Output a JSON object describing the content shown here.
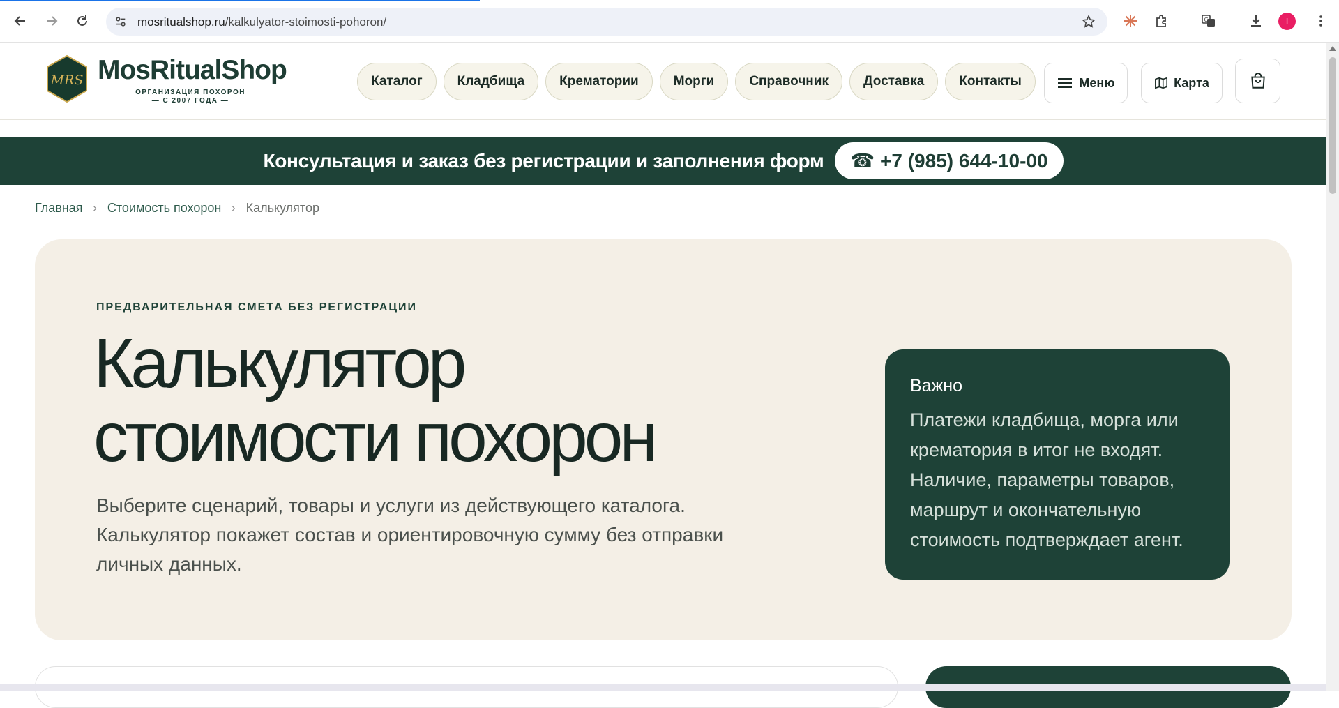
{
  "browser": {
    "url_host": "mosritualshop.ru",
    "url_path": "/kalkulyator-stoimosti-pohoron/",
    "profile_initial": "I"
  },
  "header": {
    "logo_title": "MosRitualShop",
    "logo_monogram": "MRS",
    "logo_subtitle_1": "ОРГАНИЗАЦИЯ ПОХОРОН",
    "logo_subtitle_2": "— С 2007 ГОДА —",
    "nav": [
      {
        "label": "Каталог"
      },
      {
        "label": "Кладбища"
      },
      {
        "label": "Крематории"
      },
      {
        "label": "Морги"
      },
      {
        "label": "Справочник"
      },
      {
        "label": "Доставка"
      },
      {
        "label": "Контакты"
      }
    ],
    "menu_label": "Меню",
    "map_label": "Карта"
  },
  "banner": {
    "text": "Консультация и заказ без регистрации и заполнения форм",
    "phone": "☎ +7 (985) 644-10-00"
  },
  "breadcrumb": {
    "home": "Главная",
    "parent": "Стоимость похорон",
    "current": "Калькулятор",
    "separator": "›"
  },
  "hero": {
    "eyebrow": "ПРЕДВАРИТЕЛЬНАЯ СМЕТА БЕЗ РЕГИСТРАЦИИ",
    "title": "Калькулятор стоимости похорон",
    "lead": "Выберите сценарий, товары и услуги из действующего каталога. Калькулятор покажет состав и ориентировочную сумму без отправки личных данных.",
    "notice_title": "Важно",
    "notice_body": "Платежи кладбища, морга или крематория в итог не входят. Наличие, параметры товаров, маршрут и окончательную стоимость подтверждает агент."
  },
  "colors": {
    "brand_green": "#1e4237",
    "hero_bg": "#f4efe6",
    "pill_bg": "#f6f4ea"
  }
}
